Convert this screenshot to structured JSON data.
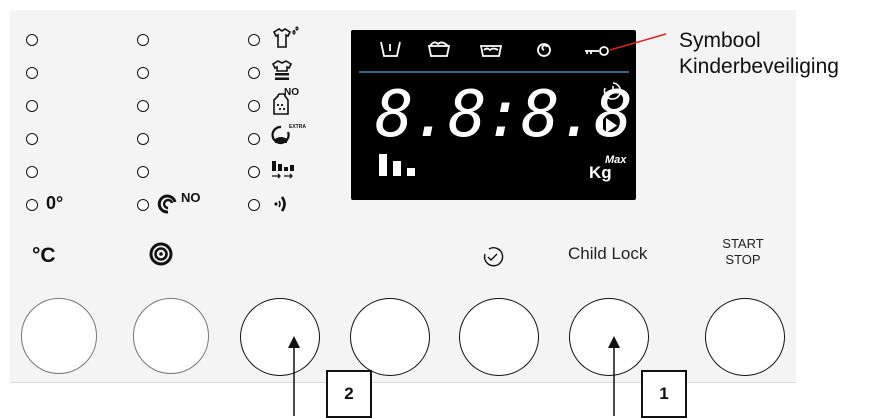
{
  "left_column": {
    "label": "0°"
  },
  "spin_column": {
    "label": "NO"
  },
  "display": {
    "digits": "8.8:8.8.",
    "max_label": "Max",
    "kg_label": "Kg"
  },
  "icons": {
    "shirt_extra_label": "NO",
    "extra_label": "EXTRA"
  },
  "buttons": {
    "celsius_label": "°C",
    "child_lock_label": "Child Lock",
    "start_label": "START",
    "stop_label": "STOP"
  },
  "callouts": {
    "symbol_label_line1": "Symbool",
    "symbol_label_line2": "Kinderbeveiliging",
    "marker_1": "1",
    "marker_2": "2"
  }
}
